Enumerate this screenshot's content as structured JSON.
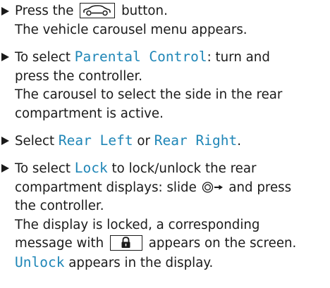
{
  "steps": [
    {
      "before": "Press the",
      "after": "button.",
      "button_icon": "vehicle-icon",
      "result": "The vehicle carousel menu appears."
    },
    {
      "prefix": "To select",
      "highlight": "Parental Control",
      "suffix": ": turn and",
      "line2": "press the controller.",
      "result_line1": "The carousel to select the side in the rear",
      "result_line2": "compartment is active."
    },
    {
      "prefix": "Select",
      "option_left": "Rear Left",
      "connector": "or",
      "option_right": "Rear Right",
      "suffix": "."
    },
    {
      "prefix": "To select",
      "highlight": "Lock",
      "suffix": "to lock/unlock the rear",
      "line2_before": "compartment displays: slide",
      "controller_icon": "controller-slide-right-icon",
      "line2_after": "and press",
      "line3": "the controller.",
      "result_line1": "The display is locked, a corresponding",
      "result_line2_before": "message with",
      "lock_icon": "padlock-icon",
      "result_line2_after": "appears on the screen.",
      "final_highlight": "Unlock",
      "final_suffix": "appears in the display."
    }
  ],
  "colors": {
    "text": "#1a1a1a",
    "highlight": "#1f86b7"
  }
}
